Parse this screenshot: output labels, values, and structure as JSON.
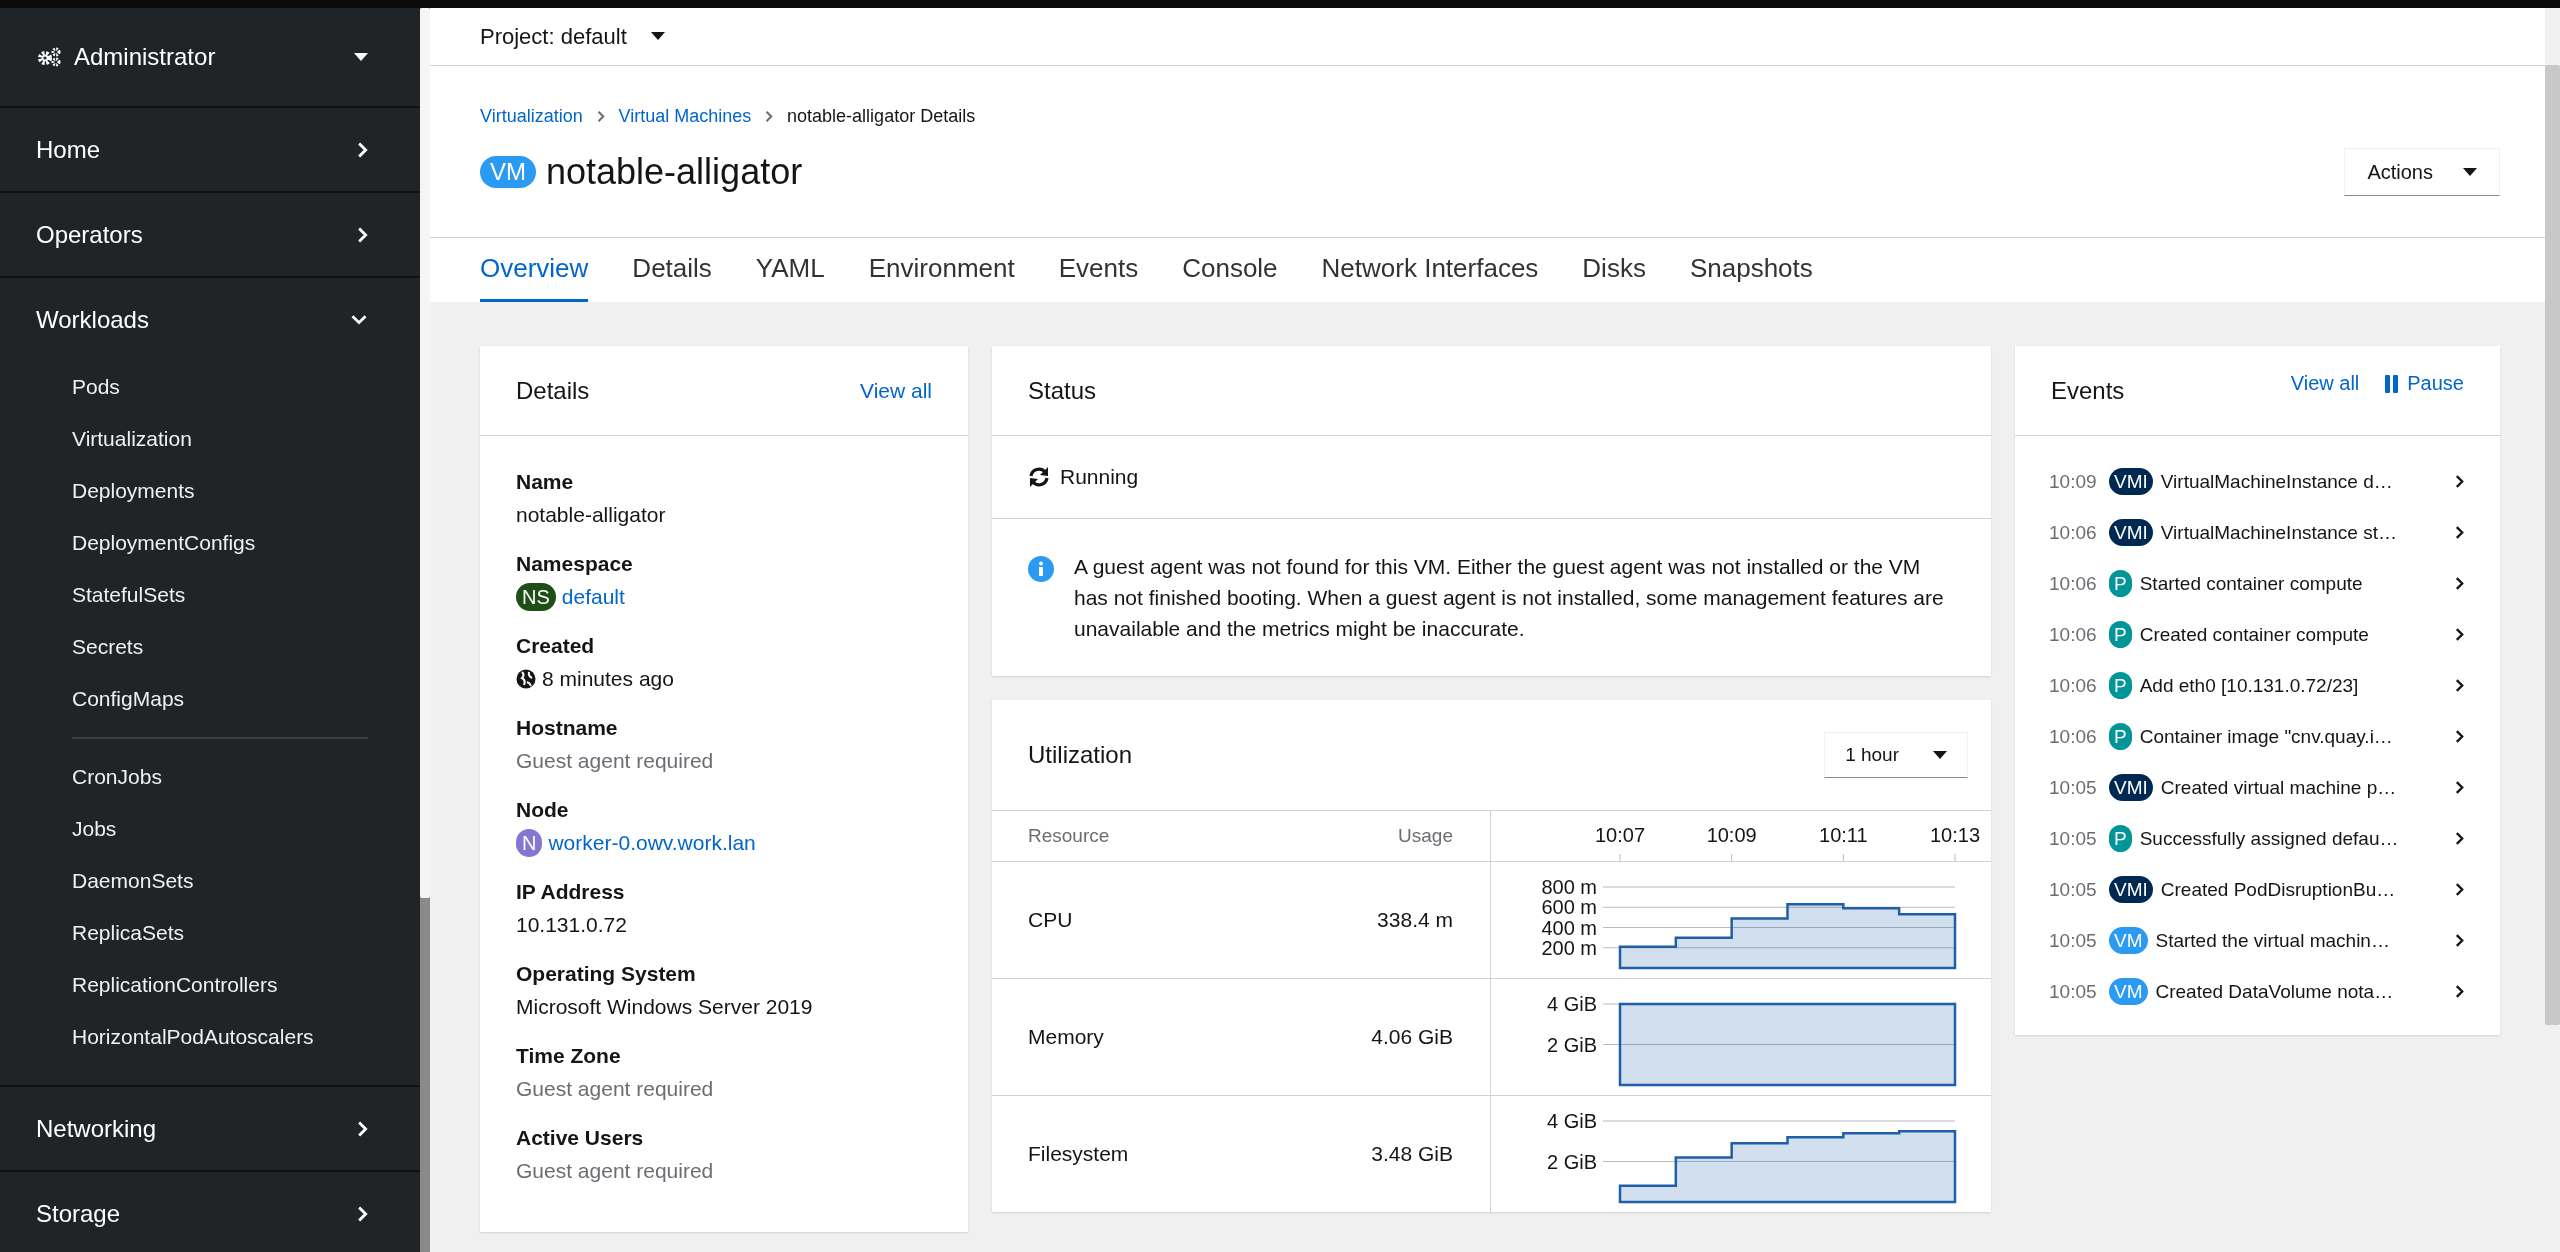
{
  "sidebar": {
    "perspective": "Administrator",
    "sections": [
      {
        "label": "Home",
        "expanded": false
      },
      {
        "label": "Operators",
        "expanded": false
      },
      {
        "label": "Workloads",
        "expanded": true,
        "children": [
          {
            "items": [
              {
                "label": "Pods",
                "selected": false
              },
              {
                "label": "Virtualization",
                "selected": false
              },
              {
                "label": "Deployments",
                "selected": false
              },
              {
                "label": "DeploymentConfigs",
                "selected": false
              },
              {
                "label": "StatefulSets",
                "selected": false
              },
              {
                "label": "Secrets",
                "selected": false
              },
              {
                "label": "ConfigMaps",
                "selected": false
              }
            ]
          },
          {
            "items": [
              {
                "label": "CronJobs",
                "selected": false
              },
              {
                "label": "Jobs",
                "selected": false
              },
              {
                "label": "DaemonSets",
                "selected": false
              },
              {
                "label": "ReplicaSets",
                "selected": false
              },
              {
                "label": "ReplicationControllers",
                "selected": false
              },
              {
                "label": "HorizontalPodAutoscalers",
                "selected": false
              }
            ]
          }
        ]
      },
      {
        "label": "Networking",
        "expanded": false
      },
      {
        "label": "Storage",
        "expanded": false
      }
    ]
  },
  "project_bar": {
    "label": "Project: default"
  },
  "breadcrumb": [
    {
      "label": "Virtualization",
      "kind": "link"
    },
    {
      "label": "Virtual Machines",
      "kind": "link"
    },
    {
      "label": "notable-alligator Details",
      "kind": "current"
    }
  ],
  "title": {
    "badge": "VM",
    "name": "notable-alligator"
  },
  "actions_button": "Actions",
  "tabs": [
    {
      "label": "Overview",
      "selected": true
    },
    {
      "label": "Details",
      "selected": false
    },
    {
      "label": "YAML",
      "selected": false
    },
    {
      "label": "Environment",
      "selected": false
    },
    {
      "label": "Events",
      "selected": false
    },
    {
      "label": "Console",
      "selected": false
    },
    {
      "label": "Network Interfaces",
      "selected": false
    },
    {
      "label": "Disks",
      "selected": false
    },
    {
      "label": "Snapshots",
      "selected": false
    }
  ],
  "details_card": {
    "title": "Details",
    "view_all": "View all",
    "fields": [
      {
        "label": "Name",
        "value": "notable-alligator",
        "kind": "plain"
      },
      {
        "label": "Namespace",
        "value": "default",
        "kind": "link",
        "badge": {
          "text": "NS",
          "color": "#1e4f18"
        }
      },
      {
        "label": "Created",
        "value": "8 minutes ago",
        "kind": "timestamp"
      },
      {
        "label": "Hostname",
        "value": "Guest agent required",
        "kind": "muted"
      },
      {
        "label": "Node",
        "value": "worker-0.owv.work.lan",
        "kind": "link",
        "badge": {
          "text": "N",
          "color": "#8476d1"
        }
      },
      {
        "label": "IP Address",
        "value": "10.131.0.72",
        "kind": "plain"
      },
      {
        "label": "Operating System",
        "value": "Microsoft Windows Server 2019",
        "kind": "plain"
      },
      {
        "label": "Time Zone",
        "value": "Guest agent required",
        "kind": "muted"
      },
      {
        "label": "Active Users",
        "value": "Guest agent required",
        "kind": "muted"
      }
    ]
  },
  "status_card": {
    "title": "Status",
    "status": "Running",
    "alert": "A guest agent was not found for this VM. Either the guest agent was not installed or the VM has not finished booting. When a guest agent is not installed, some management features are unavailable and the metrics might be inaccurate."
  },
  "utilization_card": {
    "title": "Utilization",
    "range": "1 hour",
    "columns": [
      "Resource",
      "Usage"
    ],
    "time_ticks": [
      "10:07",
      "10:09",
      "10:11",
      "10:13"
    ],
    "rows": [
      {
        "resource": "CPU",
        "usage": "338.4 m",
        "chart_data": {
          "type": "area",
          "grid": true,
          "ylim": [
            0,
            800
          ],
          "yticks": [
            {
              "value": 200,
              "label": "200 m"
            },
            {
              "value": 400,
              "label": "400 m"
            },
            {
              "value": 600,
              "label": "600 m"
            },
            {
              "value": 800,
              "label": "800 m"
            }
          ],
          "series": [
            {
              "color": "#1f5fa8",
              "values": [
                210,
                300,
                490,
                630,
                590,
                530,
                530
              ]
            }
          ]
        }
      },
      {
        "resource": "Memory",
        "usage": "4.06 GiB",
        "axis_labels": [
          "4 GiB",
          "2 GiB"
        ]
      },
      {
        "resource": "Filesystem",
        "usage": "3.48 GiB",
        "chart_data": {
          "type": "area",
          "grid": true,
          "ylim": [
            0,
            4
          ],
          "yticks": [
            {
              "value": 2,
              "label": "2 GiB"
            },
            {
              "value": 4,
              "label": "4 GiB"
            }
          ],
          "series": [
            {
              "color": "#1f5fa8",
              "values": [
                0.8,
                2.2,
                2.9,
                3.2,
                3.4,
                3.5,
                3.5
              ]
            }
          ]
        }
      }
    ]
  },
  "events_card": {
    "title": "Events",
    "view_all": "View all",
    "pause": "Pause",
    "events": [
      {
        "time": "10:09",
        "badge": {
          "text": "VMI",
          "color": "#002952"
        },
        "message": "VirtualMachineInstance d…"
      },
      {
        "time": "10:06",
        "badge": {
          "text": "VMI",
          "color": "#002952"
        },
        "message": "VirtualMachineInstance st…"
      },
      {
        "time": "10:06",
        "badge": {
          "text": "P",
          "color": "#009596"
        },
        "message": "Started container compute"
      },
      {
        "time": "10:06",
        "badge": {
          "text": "P",
          "color": "#009596"
        },
        "message": "Created container compute"
      },
      {
        "time": "10:06",
        "badge": {
          "text": "P",
          "color": "#009596"
        },
        "message": "Add eth0 [10.131.0.72/23]"
      },
      {
        "time": "10:06",
        "badge": {
          "text": "P",
          "color": "#009596"
        },
        "message": "Container image \"cnv.quay.i…"
      },
      {
        "time": "10:05",
        "badge": {
          "text": "VMI",
          "color": "#002952"
        },
        "message": "Created virtual machine p…"
      },
      {
        "time": "10:05",
        "badge": {
          "text": "P",
          "color": "#009596"
        },
        "message": "Successfully assigned defau…"
      },
      {
        "time": "10:05",
        "badge": {
          "text": "VMI",
          "color": "#002952"
        },
        "message": "Created PodDisruptionBu…"
      },
      {
        "time": "10:05",
        "badge": {
          "text": "VM",
          "color": "#2b9af3"
        },
        "message": "Started the virtual machin…"
      },
      {
        "time": "10:05",
        "badge": {
          "text": "VM",
          "color": "#2b9af3"
        },
        "message": "Created DataVolume nota…"
      }
    ]
  }
}
